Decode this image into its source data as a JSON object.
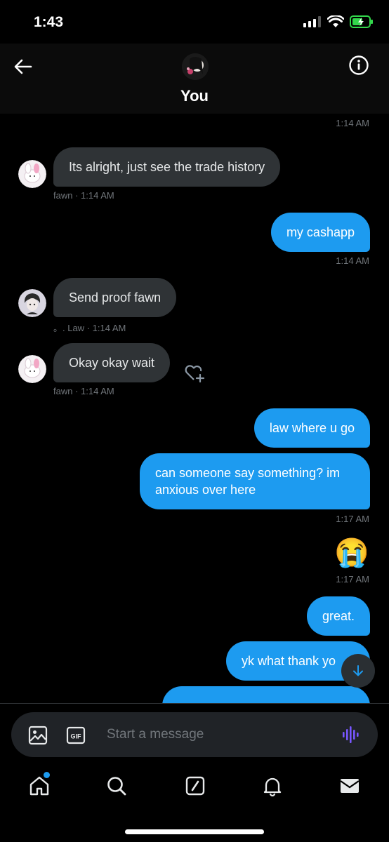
{
  "status_bar": {
    "time": "1:43"
  },
  "header": {
    "title": "You"
  },
  "messages": [
    {
      "sender": "",
      "text": "",
      "time": "1:14 AM"
    },
    {
      "sender": "fawn",
      "text": "Its alright, just see the trade history",
      "meta": "fawn · 1:14 AM"
    },
    {
      "sender": "You",
      "text": "my cashapp",
      "time": "1:14 AM"
    },
    {
      "sender": "。. Law",
      "text": "Send proof fawn",
      "meta": "。. Law · 1:14 AM"
    },
    {
      "sender": "fawn",
      "text": "Okay okay wait",
      "meta": "fawn · 1:14 AM"
    },
    {
      "sender": "You",
      "text": "law where u go"
    },
    {
      "sender": "You",
      "text_line1": "can someone say something? im",
      "text_line2": "anxious over here",
      "time": "1:17 AM"
    },
    {
      "sender": "You",
      "text": "😭",
      "time": "1:17 AM"
    },
    {
      "sender": "You",
      "text": "great."
    },
    {
      "sender": "You",
      "text": "yk what thank yo"
    }
  ],
  "composer": {
    "placeholder": "Start a message"
  },
  "icons": {
    "back": "arrow-left-icon",
    "info": "info-icon",
    "react": "heart-plus-icon",
    "scroll": "arrow-down-icon",
    "image": "image-icon",
    "gif": "gif-icon",
    "voice": "voice-wave-icon",
    "tabs": [
      "home-icon",
      "search-icon",
      "compose-icon",
      "bell-icon",
      "mail-icon"
    ]
  },
  "colors": {
    "accent": "#1d9bf0",
    "incoming_bubble": "#2f3336",
    "voice": "#7856ff"
  }
}
